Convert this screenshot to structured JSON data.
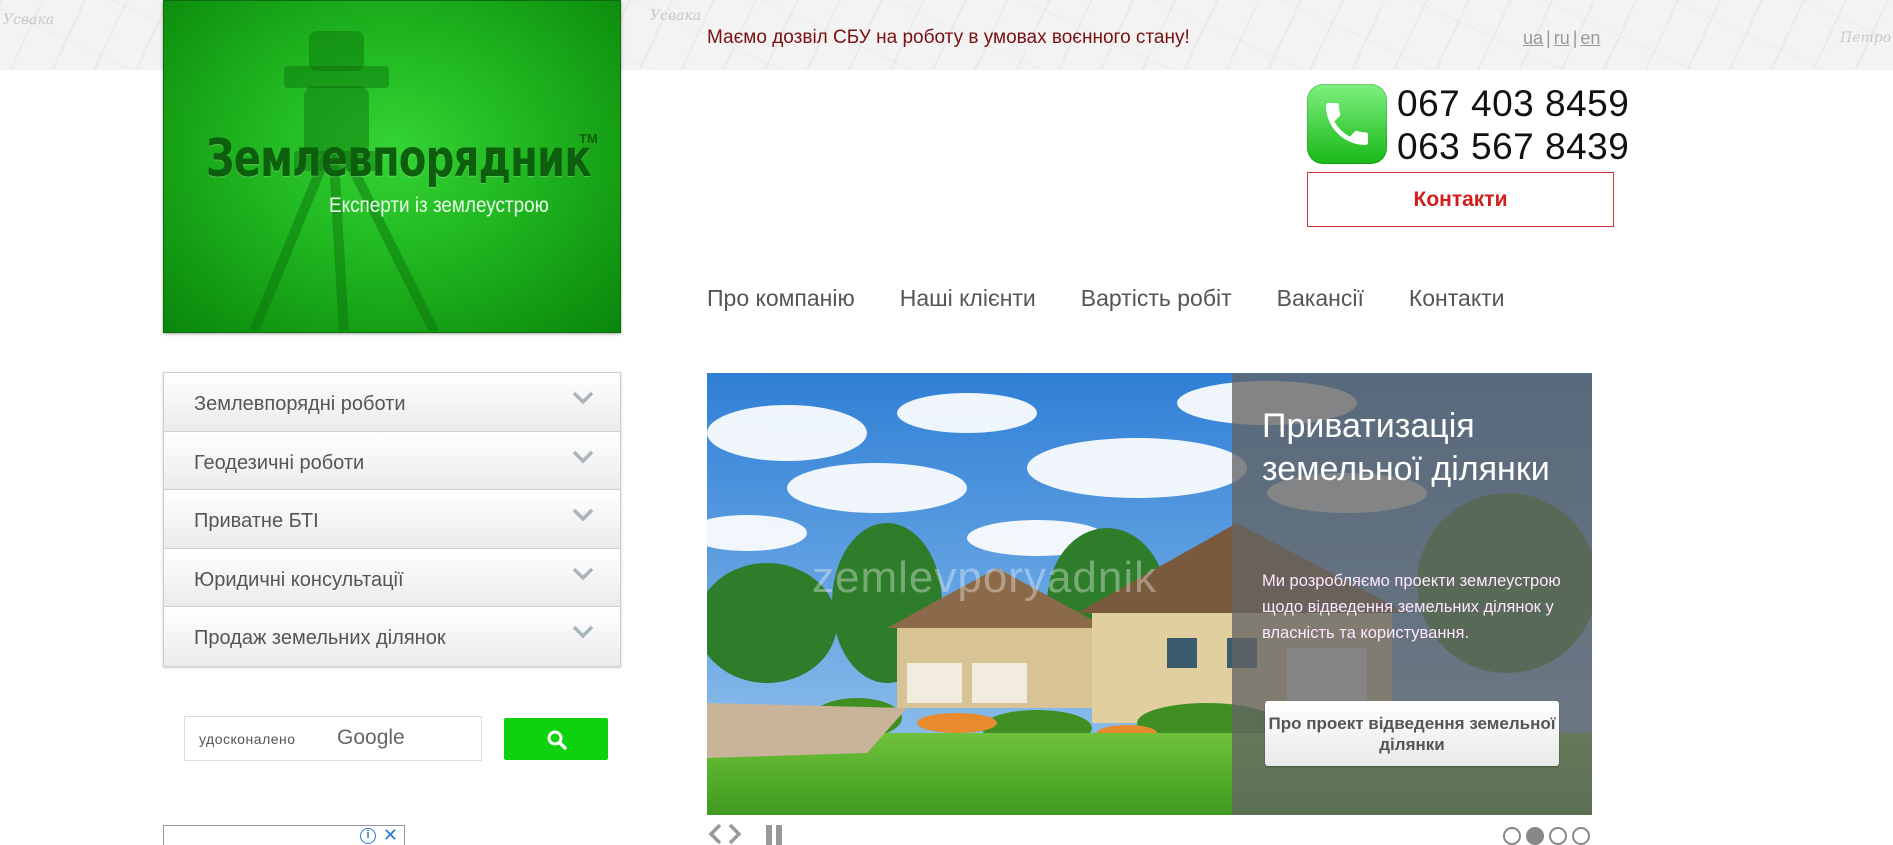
{
  "header": {
    "logo": {
      "title": "Землевпорядник",
      "tm": "TM",
      "subtitle": "Експерти із землеустрою"
    },
    "notice": "Маємо дозвіл СБУ на роботу в умовах воєнного стану!",
    "languages": [
      "ua",
      "ru",
      "en"
    ],
    "phones": [
      "067 403 8459",
      "063 567 8439"
    ],
    "contacts_button": "Контакти",
    "map_labels": [
      "Усвака",
      "Усвака",
      "Петро"
    ]
  },
  "nav": {
    "items": [
      "Про компанію",
      "Наші клієнти",
      "Вартість робіт",
      "Вакансії",
      "Контакти"
    ]
  },
  "sidebar": {
    "items": [
      {
        "label": "Землевпорядні роботи"
      },
      {
        "label": "Геодезичні роботи"
      },
      {
        "label": "Приватне БТІ"
      },
      {
        "label": "Юридичні консультації"
      },
      {
        "label": "Продаж земельних ділянок"
      }
    ],
    "search": {
      "placeholder": "удосконалено",
      "brand": "Google"
    }
  },
  "slider": {
    "title": "Приватизація земельної ділянки",
    "description": "Ми розробляємо проекти землеустрою щодо відведення земельних ділянок у власність та користування.",
    "button": "Про проект відведення земельної ділянки",
    "watermark": "zemlevporyadnik",
    "dots": 4,
    "active_dot": 1
  },
  "colors": {
    "brand_green": "#1fb51f",
    "notice_red": "#7a1010",
    "contact_red": "#d21d1d",
    "search_green": "#0ed20e"
  }
}
